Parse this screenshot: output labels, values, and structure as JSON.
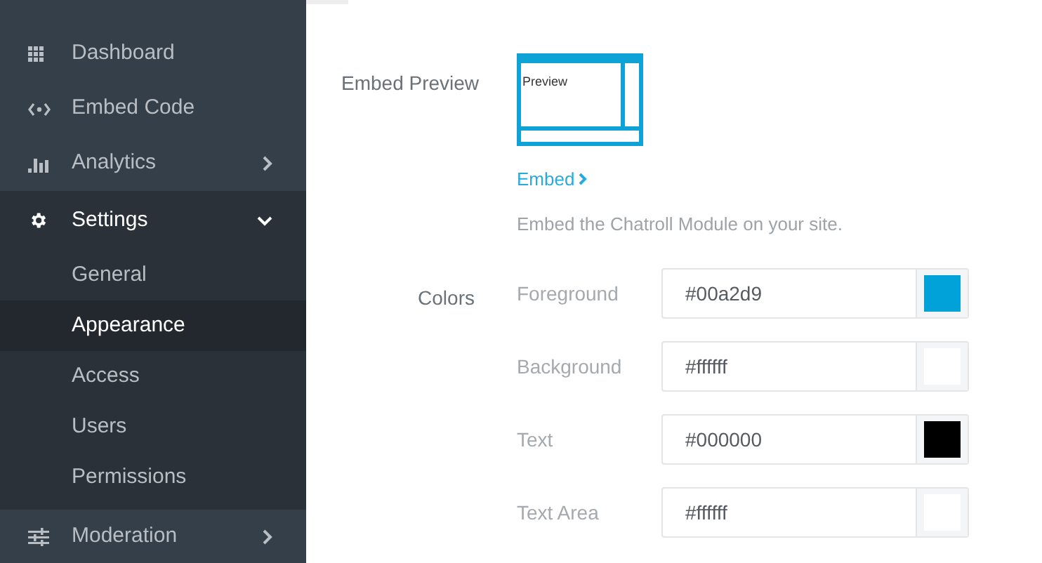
{
  "sidebar": {
    "items": [
      {
        "kind": "link",
        "label": "Dashboard",
        "selected": false
      },
      {
        "kind": "link",
        "label": "Embed Code",
        "selected": false
      },
      {
        "kind": "group",
        "label": "Analytics",
        "expanded": false,
        "selected": false
      },
      {
        "kind": "group",
        "label": "Settings",
        "expanded": true,
        "selected": true,
        "children": [
          {
            "label": "General",
            "selected": false
          },
          {
            "label": "Appearance",
            "selected": true
          },
          {
            "label": "Access",
            "selected": false
          },
          {
            "label": "Users",
            "selected": false
          },
          {
            "label": "Permissions",
            "selected": false
          }
        ]
      },
      {
        "kind": "group",
        "label": "Moderation",
        "expanded": false,
        "selected": false
      }
    ]
  },
  "embed_preview": {
    "label": "Embed Preview",
    "preview_text": "Preview",
    "link": "Embed",
    "description": "Embed the Chatroll Module on your site."
  },
  "colors": {
    "label": "Colors",
    "rows": [
      {
        "label": "Foreground",
        "value": "#00a2d9",
        "color": "#00a2d9"
      },
      {
        "label": "Background",
        "value": "#ffffff",
        "color": "#ffffff"
      },
      {
        "label": "Text",
        "value": "#000000",
        "color": "#000000"
      },
      {
        "label": "Text Area",
        "value": "#ffffff",
        "color": "#ffffff"
      }
    ]
  }
}
